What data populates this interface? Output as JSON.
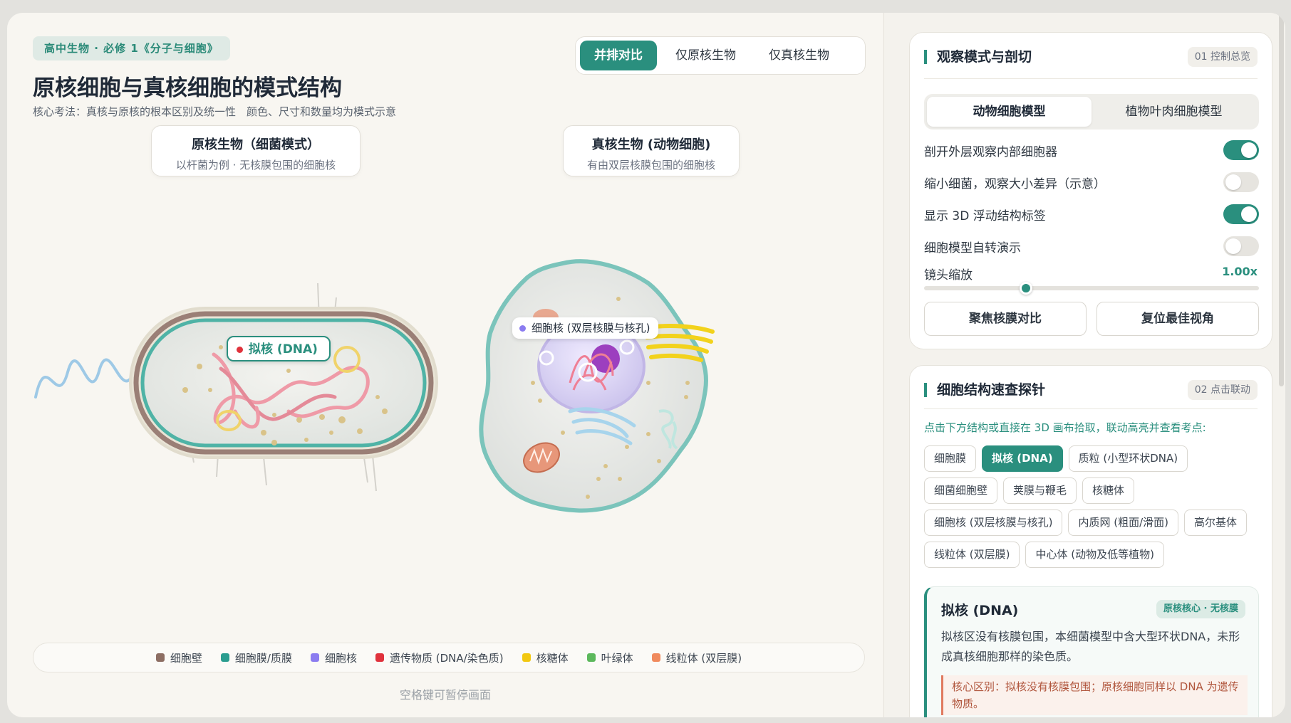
{
  "header": {
    "course_chip": "高中生物 · 必修 1《分子与细胞》",
    "title": "原核细胞与真核细胞的模式结构",
    "subtitle": "核心考法：真核与原核的根本区别及统一性　颜色、尺寸和数量均为模式示意"
  },
  "view_tabs": [
    {
      "label": "并排对比",
      "active": true
    },
    {
      "label": "仅原核生物",
      "active": false
    },
    {
      "label": "仅真核生物",
      "active": false
    }
  ],
  "prokaryote_card": {
    "title": "原核生物（细菌模式）",
    "desc": "以杆菌为例 · 无核膜包围的细胞核"
  },
  "eukaryote_card": {
    "title": "真核生物 (动物细胞)",
    "desc": "有由双层核膜包围的细胞核"
  },
  "labels": {
    "nucleoid": {
      "text": "拟核 (DNA)",
      "color": "#e0323c"
    },
    "nucleus": {
      "text": "细胞核 (双层核膜与核孔)",
      "color": "#8b7cf0"
    }
  },
  "legend": [
    {
      "label": "细胞壁",
      "color": "#8d6e63"
    },
    {
      "label": "细胞膜/质膜",
      "color": "#2a9d8f"
    },
    {
      "label": "细胞核",
      "color": "#8b7cf0"
    },
    {
      "label": "遗传物质 (DNA/染色质)",
      "color": "#e0323c"
    },
    {
      "label": "核糖体",
      "color": "#f2c811"
    },
    {
      "label": "叶绿体",
      "color": "#5cb85c"
    },
    {
      "label": "线粒体 (双层膜)",
      "color": "#f08a5d"
    }
  ],
  "hint": "空格键可暂停画面",
  "control_panel": {
    "title": "观察模式与剖切",
    "badge": "01 控制总览",
    "model_tabs": [
      {
        "label": "动物细胞模型",
        "active": true
      },
      {
        "label": "植物叶肉细胞模型",
        "active": false
      }
    ],
    "toggles": [
      {
        "label": "剖开外层观察内部细胞器",
        "on": true
      },
      {
        "label": "缩小细菌，观察大小差异（示意）",
        "on": false
      },
      {
        "label": "显示 3D 浮动结构标签",
        "on": true
      },
      {
        "label": "细胞模型自转演示",
        "on": false
      }
    ],
    "zoom_label": "镜头缩放",
    "zoom_value": "1.00x",
    "zoom_fraction": 0.32,
    "focus_button": "聚焦核膜对比",
    "reset_button": "复位最佳视角"
  },
  "probe_panel": {
    "title": "细胞结构速查探针",
    "badge": "02 点击联动",
    "hint": "点击下方结构或直接在 3D 画布拾取，联动高亮并查看考点:",
    "structures": [
      {
        "label": "细胞膜",
        "active": false
      },
      {
        "label": "拟核 (DNA)",
        "active": true
      },
      {
        "label": "质粒 (小型环状DNA)",
        "active": false
      },
      {
        "label": "细菌细胞壁",
        "active": false
      },
      {
        "label": "荚膜与鞭毛",
        "active": false
      },
      {
        "label": "核糖体",
        "active": false
      },
      {
        "label": "细胞核 (双层核膜与核孔)",
        "active": false
      },
      {
        "label": "内质网 (粗面/滑面)",
        "active": false
      },
      {
        "label": "高尔基体",
        "active": false
      },
      {
        "label": "线粒体 (双层膜)",
        "active": false
      },
      {
        "label": "中心体 (动物及低等植物)",
        "active": false
      }
    ],
    "detail": {
      "title": "拟核 (DNA)",
      "tag": "原核核心 · 无核膜",
      "desc": "拟核区没有核膜包围，本细菌模型中含大型环状DNA，未形成真核细胞那样的染色质。",
      "key": "核心区别：拟核没有核膜包围；原核细胞同样以 DNA 为遗传物质。"
    }
  }
}
